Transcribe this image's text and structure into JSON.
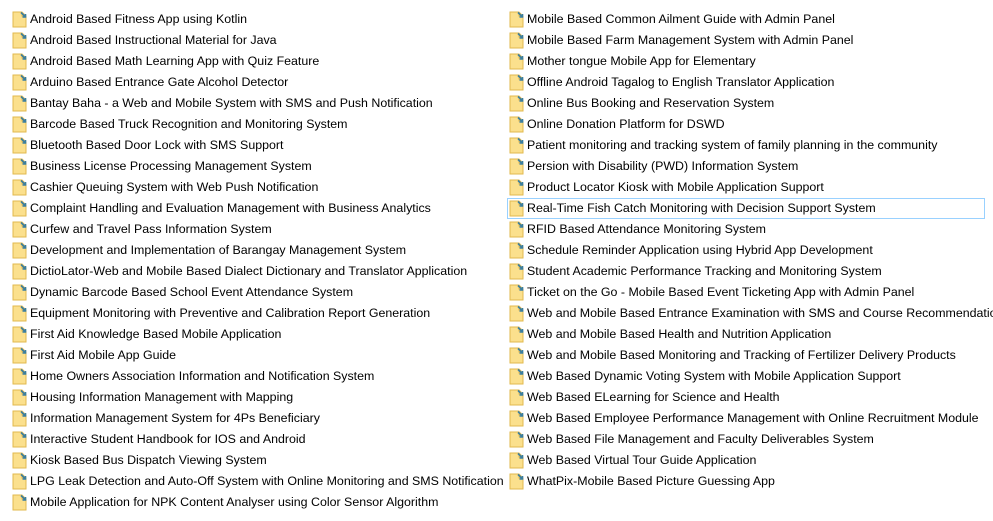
{
  "icon_name": "folder-shortcut-icon",
  "colors": {
    "icon_fill": "#fbe08d",
    "icon_edge": "#e2b94e",
    "icon_arrow": "#3a7ea0",
    "selection_border": "#99d1ff"
  },
  "selected_item": "Real-Time Fish Catch Monitoring with Decision Support System",
  "left_column": [
    "Android Based Fitness App using Kotlin",
    "Android Based Instructional Material for Java",
    "Android Based Math Learning App with Quiz Feature",
    "Arduino Based Entrance Gate Alcohol Detector",
    "Bantay Baha - a Web and Mobile System with SMS and Push Notification",
    "Barcode Based Truck Recognition and Monitoring System",
    "Bluetooth Based Door Lock with SMS Support",
    "Business License Processing Management System",
    "Cashier Queuing System with Web Push Notification",
    "Complaint Handling and Evaluation Management with Business Analytics",
    "Curfew and Travel Pass Information System",
    "Development and Implementation of Barangay Management System",
    "DictioLator-Web and Mobile Based Dialect Dictionary and Translator Application",
    "Dynamic Barcode Based School Event Attendance System",
    "Equipment Monitoring with Preventive and Calibration Report Generation",
    "First Aid Knowledge Based Mobile Application",
    "First Aid Mobile App Guide",
    "Home Owners Association Information and Notification System",
    "Housing Information Management with Mapping",
    "Information Management System for 4Ps Beneficiary",
    "Interactive Student Handbook for IOS and Android",
    "Kiosk Based Bus Dispatch Viewing System",
    "LPG Leak Detection and Auto-Off System with Online Monitoring and SMS Notification",
    "Mobile Application for NPK Content Analyser using Color Sensor Algorithm"
  ],
  "right_column": [
    "Mobile Based Common Ailment Guide with Admin Panel",
    "Mobile Based Farm Management System with Admin Panel",
    "Mother tongue Mobile App for Elementary",
    "Offline Android Tagalog to English Translator Application",
    "Online Bus Booking and Reservation System",
    "Online Donation Platform for DSWD",
    "Patient monitoring and tracking system of family planning in the community",
    "Persion with Disability (PWD) Information System",
    "Product Locator Kiosk with Mobile Application Support",
    "Real-Time Fish Catch Monitoring with Decision Support System",
    "RFID Based Attendance Monitoring System",
    "Schedule Reminder Application using Hybrid App Development",
    "Student Academic Performance Tracking and Monitoring System",
    "Ticket on the Go - Mobile Based Event Ticketing App with Admin Panel",
    "Web and Mobile Based Entrance Examination with SMS and Course Recommendation",
    "Web and Mobile Based Health and Nutrition Application",
    "Web and Mobile Based Monitoring and Tracking of Fertilizer Delivery Products",
    "Web Based Dynamic Voting System with Mobile Application Support",
    "Web Based ELearning for Science and Health",
    "Web Based Employee Performance Management with Online Recruitment Module",
    "Web Based File Management and Faculty Deliverables System",
    "Web Based Virtual Tour Guide Application",
    "WhatPix-Mobile Based Picture Guessing App"
  ]
}
